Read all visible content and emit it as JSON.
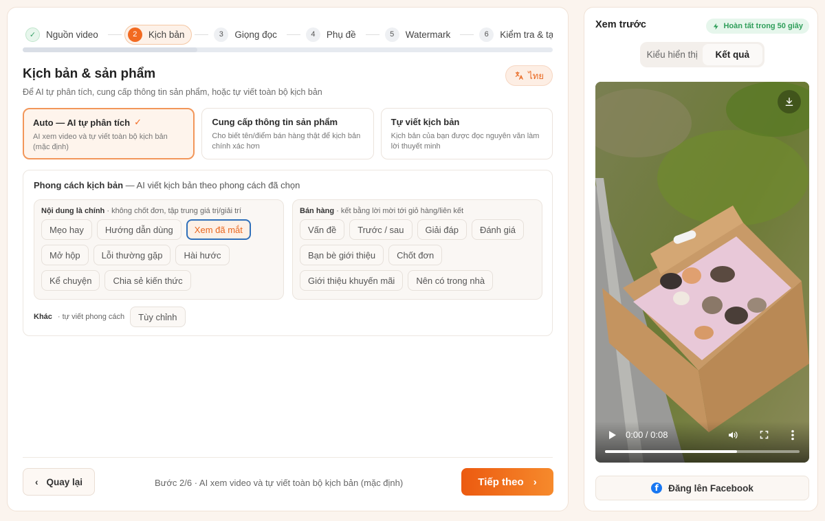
{
  "steps": [
    {
      "num": "✓",
      "label": "Nguồn video",
      "state": "done"
    },
    {
      "num": "2",
      "label": "Kịch bản",
      "state": "active"
    },
    {
      "num": "3",
      "label": "Giọng đọc",
      "state": "todo"
    },
    {
      "num": "4",
      "label": "Phụ đề",
      "state": "todo"
    },
    {
      "num": "5",
      "label": "Watermark",
      "state": "todo"
    },
    {
      "num": "6",
      "label": "Kiểm tra & tạ",
      "state": "todo"
    }
  ],
  "progress": 0.33,
  "header": {
    "title": "Kịch bản & sản phẩm",
    "subtitle": "Để AI tự phân tích, cung cấp thông tin sản phẩm, hoặc tự viết toàn bộ kịch bản",
    "lang_label": "ไทย"
  },
  "modes": [
    {
      "title": "Auto — AI tự phân tích",
      "desc": "AI xem video và tự viết toàn bộ kịch bản (mặc định)",
      "selected": true
    },
    {
      "title": "Cung cấp thông tin sản phẩm",
      "desc": "Cho biết tên/điểm bán hàng thật để kịch bản chính xác hơn",
      "selected": false
    },
    {
      "title": "Tự viết kịch bản",
      "desc": "Kịch bản của bạn được đọc nguyên văn làm lời thuyết minh",
      "selected": false
    }
  ],
  "style": {
    "head_bold": "Phong cách kịch bản",
    "head_rest": "— AI viết kịch bản theo phong cách đã chọn",
    "content_group": {
      "title": "Nội dung là chính",
      "note": "· không chốt đơn, tập trung giá trị/giải trí",
      "chips": [
        "Mẹo hay",
        "Hướng dẫn dùng",
        "Xem đã mắt",
        "Mở hộp",
        "Lỗi thường gặp",
        "Hài hước",
        "Kể chuyện",
        "Chia sẻ kiến thức"
      ],
      "selected": "Xem đã mắt"
    },
    "sales_group": {
      "title": "Bán hàng",
      "note": "· kết bằng lời mời tới giỏ hàng/liên kết",
      "chips": [
        "Vấn đề",
        "Trước / sau",
        "Giải đáp",
        "Đánh giá",
        "Bạn bè giới thiệu",
        "Chốt đơn",
        "Giới thiệu khuyến mãi",
        "Nên có trong nhà"
      ]
    },
    "other": {
      "title": "Khác",
      "note": "· tự viết phong cách",
      "chip": "Tùy chỉnh"
    }
  },
  "footer": {
    "back_label": "Quay lại",
    "status": "Bước 2/6 · AI xem video và tự viết toàn bộ kịch bản (mặc định)",
    "next_label": "Tiếp theo"
  },
  "preview": {
    "title": "Xem trước",
    "badge": "Hoàn tất trong 50 giây",
    "tabs": [
      "Kiểu hiển thị",
      "Kết quả"
    ],
    "active_tab": "Kết quả",
    "video_time": "0:00 / 0:08",
    "video_progress": 0.68,
    "fb_label": "Đăng lên Facebook"
  },
  "colors": {
    "accent": "#f26a21",
    "success": "#2f9e5a",
    "selected_outline": "#2e6fba",
    "facebook": "#1877f2"
  }
}
